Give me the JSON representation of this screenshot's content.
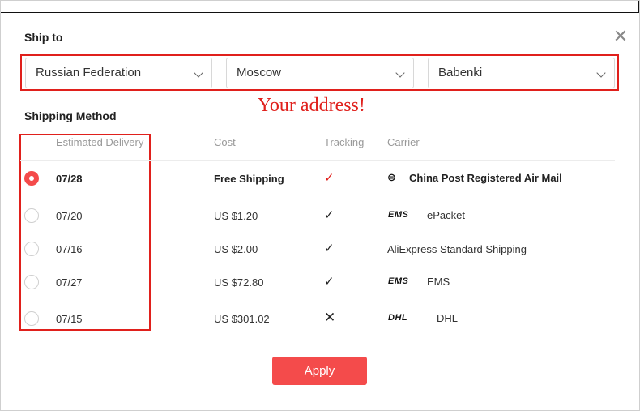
{
  "ship_to": {
    "title": "Ship to",
    "country": "Russian Federation",
    "city": "Moscow",
    "district": "Babenki",
    "annotation": "Your address!"
  },
  "shipping": {
    "title": "Shipping Method",
    "headers": {
      "delivery": "Estimated Delivery",
      "cost": "Cost",
      "tracking": "Tracking",
      "carrier": "Carrier"
    },
    "rows": [
      {
        "date": "07/28",
        "cost": "Free Shipping",
        "tracking": "✓",
        "carrier_logo": "",
        "carrier": "China Post Registered Air Mail",
        "selected": true
      },
      {
        "date": "07/20",
        "cost": "US $1.20",
        "tracking": "✓",
        "carrier_logo": "EMS",
        "carrier": "ePacket",
        "selected": false
      },
      {
        "date": "07/16",
        "cost": "US $2.00",
        "tracking": "✓",
        "carrier_logo": "",
        "carrier": "AliExpress Standard Shipping",
        "selected": false
      },
      {
        "date": "07/27",
        "cost": "US $72.80",
        "tracking": "✓",
        "carrier_logo": "EMS",
        "carrier": "EMS",
        "selected": false
      },
      {
        "date": "07/15",
        "cost": "US $301.02",
        "tracking": "✕",
        "carrier_logo": "DHL",
        "carrier": "DHL",
        "selected": false
      }
    ]
  },
  "actions": {
    "apply_label": "Apply",
    "close_icon": "close-icon"
  },
  "colors": {
    "accent": "#f44b4b",
    "annotation": "#e0201c"
  }
}
